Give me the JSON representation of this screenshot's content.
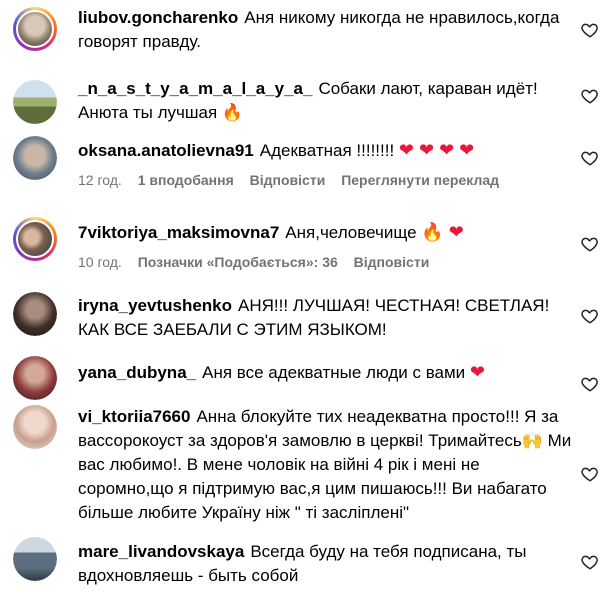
{
  "comments": [
    {
      "username": "liubov.goncharenko",
      "text": "Аня никому никогда не нравилось,когда говорят правду."
    },
    {
      "username": "_n_a_s_t_y_a_m_a_l_a_y_a_",
      "text": "Собаки лают, караван идёт! Анюта ты лучшая",
      "emoji": "🔥"
    },
    {
      "username": "oksana.anatolievna91",
      "text": "Адекватная !!!!!!!!",
      "emoji": "❤ ❤ ❤ ❤",
      "time": "12 год.",
      "likes": "1 вподобання",
      "reply": "Відповісти",
      "translate": "Переглянути переклад"
    },
    {
      "username": "7viktoriya_maksimovna7",
      "text": "Аня,человечище",
      "emoji": "🔥 ❤",
      "time": "10 год.",
      "likes": "Позначки «Подобається»: 36",
      "reply": "Відповісти"
    },
    {
      "username": "iryna_yevtushenko",
      "text": "АНЯ!!! ЛУЧШАЯ! ЧЕСТНАЯ! СВЕТЛАЯ! КАК ВСЕ ЗАЕБАЛИ С ЭТИМ ЯЗЫКОМ!"
    },
    {
      "username": "yana_dubyna_",
      "text": "Аня все адекватные люди с вами",
      "emoji": "❤"
    },
    {
      "username": "vi_ktoriia7660",
      "text": "Анна блокуйте тих неадекватна просто!!! Я за вассорокоуст за здоров'я замовлю в церкві! Тримайтесь",
      "emoji2": "🙌",
      "text2": "Ми вас любимо!. В мене чоловік на війні 4 рік і мені не соромно,що я підтримую вас,я цим пишаюсь!!! Ви набагато більше любите Україну ніж \" ті засліплені\""
    },
    {
      "username": "mare_livandovskaya",
      "text": "Всегда буду на тебя подписана, ты вдохновляешь - быть собой"
    }
  ],
  "colors": {
    "heart": "#e8173c",
    "meta": "#737373",
    "ring": "#d62976"
  },
  "icons": {
    "like": "heart-outline-icon"
  }
}
